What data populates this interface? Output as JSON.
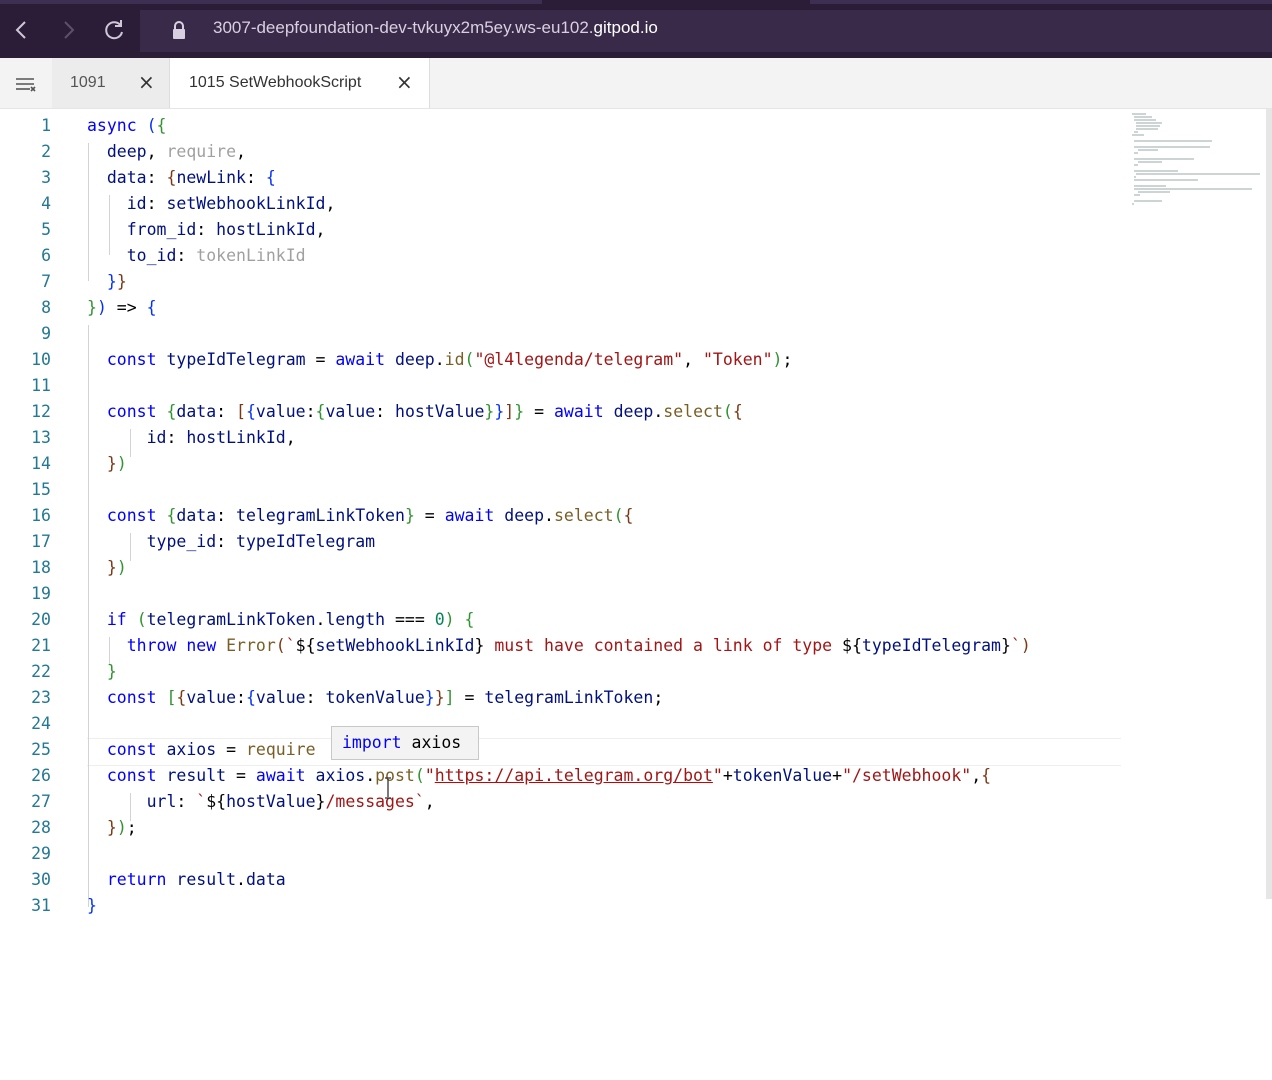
{
  "browser": {
    "url_prefix": "3007-deepfoundation-dev-tvkuyx2m5ey.ws-eu102.",
    "url_domain": "gitpod.io",
    "back_icon": "chevron-left-icon",
    "forward_icon": "chevron-right-icon",
    "reload_icon": "reload-icon",
    "lock_icon": "lock-icon"
  },
  "tabs": [
    {
      "label": "1091",
      "close": "×",
      "active": false
    },
    {
      "label": "1015 SetWebhookScript",
      "close": "×",
      "active": true
    }
  ],
  "editor": {
    "line_numbers": [
      "1",
      "2",
      "3",
      "4",
      "5",
      "6",
      "7",
      "8",
      "9",
      "10",
      "11",
      "12",
      "13",
      "14",
      "15",
      "16",
      "17",
      "18",
      "19",
      "20",
      "21",
      "22",
      "23",
      "24",
      "25",
      "26",
      "27",
      "28",
      "29",
      "30",
      "31"
    ],
    "tooltip": "import axios"
  },
  "colors": {
    "keyword": "#0000ff",
    "string": "#a31515",
    "line_number": "#237893",
    "browser_bar": "#2b1d38"
  }
}
